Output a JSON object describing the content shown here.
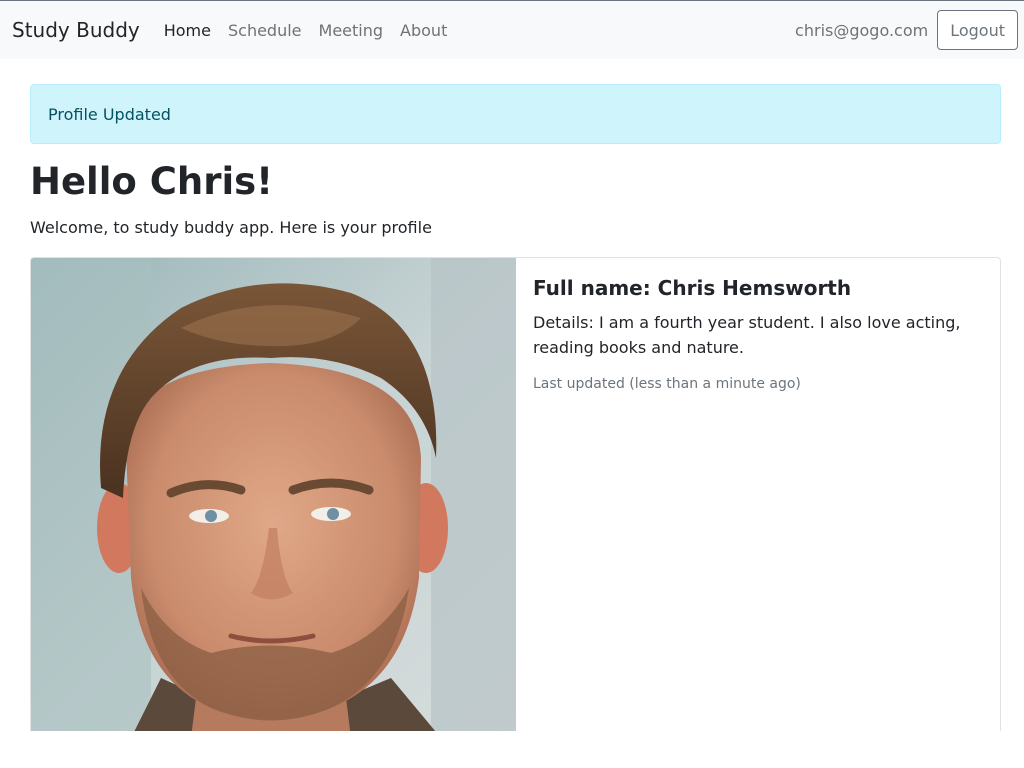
{
  "navbar": {
    "brand": "Study Buddy",
    "links": [
      {
        "label": "Home",
        "active": true
      },
      {
        "label": "Schedule",
        "active": false
      },
      {
        "label": "Meeting",
        "active": false
      },
      {
        "label": "About",
        "active": false
      }
    ],
    "user_email": "chris@gogo.com",
    "logout_label": "Logout"
  },
  "alert": {
    "message": "Profile Updated"
  },
  "main": {
    "title": "Hello Chris!",
    "welcome": "Welcome, to study buddy app. Here is your profile"
  },
  "profile": {
    "full_name": "Full name: Chris Hemsworth",
    "details": "Details: I am a fourth year student. I also love acting, reading books and nature.",
    "last_updated": "Last updated (less than a minute ago)"
  }
}
